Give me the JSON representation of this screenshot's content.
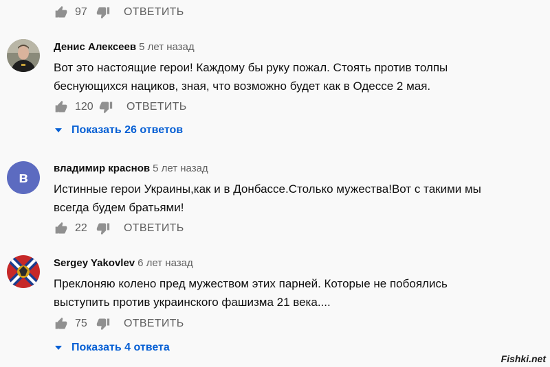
{
  "top_actions": {
    "likes": "97",
    "reply_label": "ОТВЕТИТЬ"
  },
  "comments": [
    {
      "author": "Денис Алексеев",
      "time": "5 лет назад",
      "text_lines": [
        "Вот это настоящие герои! Каждому бы руку пожал. Стоять против толпы",
        "беснующихся нациков, зная, что возможно будет как в Одессе 2 мая."
      ],
      "likes": "120",
      "reply_label": "ОТВЕТИТЬ",
      "show_replies": "Показать 26 ответов"
    },
    {
      "author": "владимир краснов",
      "time": "5 лет назад",
      "avatar_letter": "в",
      "avatar_color": "#5c6bc0",
      "text_lines": [
        "Истинные герои Украины,как и в Донбассе.Столько мужества!Вот с такими мы",
        "всегда будем братьями!"
      ],
      "likes": "22",
      "reply_label": "ОТВЕТИТЬ"
    },
    {
      "author": "Sergey Yakovlev",
      "time": "6 лет назад",
      "text_lines": [
        "Преклоняю колено пред мужеством этих парней. Которые не побоялись",
        "выступить против украинского фашизма 21 века...."
      ],
      "likes": "75",
      "reply_label": "ОТВЕТИТЬ",
      "show_replies": "Показать 4 ответа"
    }
  ],
  "watermark": "Fishki.net",
  "colors": {
    "link": "#065fd4",
    "icon": "#909090",
    "secondary_text": "#606060"
  }
}
